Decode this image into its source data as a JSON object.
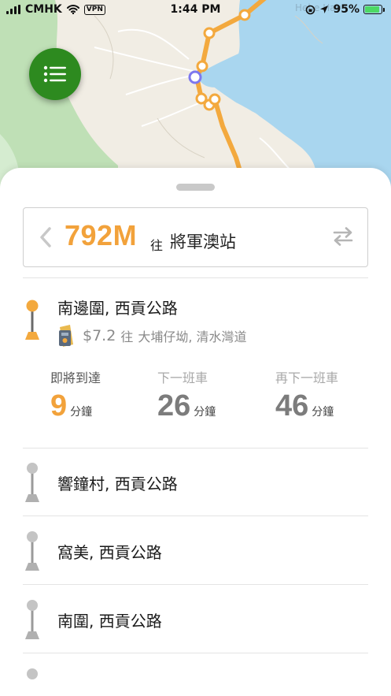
{
  "status_bar": {
    "carrier": "CMHK",
    "vpn": "VPN",
    "time": "1:44 PM",
    "battery": "95%"
  },
  "map": {
    "place_label": "Hebe Hav"
  },
  "route": {
    "number": "792M",
    "to_word": "往",
    "destination": "將軍澳站",
    "accent_color": "#f2a23b"
  },
  "selected_stop": {
    "name": "南邊圍, 西貢公路",
    "fare": "$7.2",
    "fare_to_word": "往",
    "fare_via": "大埔仔坳, 清水灣道"
  },
  "etas": [
    {
      "label": "即將到達",
      "value": "9",
      "unit": "分鐘"
    },
    {
      "label": "下一班車",
      "value": "26",
      "unit": "分鐘"
    },
    {
      "label": "再下一班車",
      "value": "46",
      "unit": "分鐘"
    }
  ],
  "stops": [
    {
      "name": "響鐘村, 西貢公路"
    },
    {
      "name": "窩美, 西貢公路"
    },
    {
      "name": "南圍, 西貢公路"
    }
  ],
  "icons": {
    "menu": "list-icon",
    "back": "chevron-left-icon",
    "swap": "swap-direction-icon",
    "stop": "bus-stop-pin-icon",
    "fare": "octopus-card-icon"
  }
}
